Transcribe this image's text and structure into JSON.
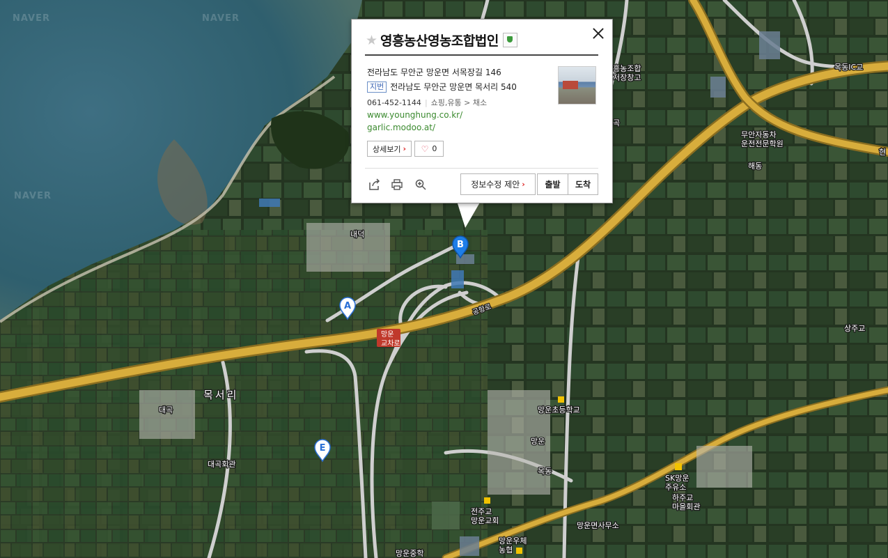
{
  "watermark": "NAVER",
  "place": {
    "name": "영흥농산영농조합법인",
    "road_address": "전라남도 무안군 망운면 서목장길 146",
    "jibun_tag": "지번",
    "jibun_address": "전라남도 무안군 망운면 목서리 540",
    "phone": "061-452-1144",
    "category": "쇼핑,유통 > 채소",
    "urls": [
      "www.younghung.co.kr/",
      "garlic.modoo.at/"
    ],
    "detail_label": "상세보기",
    "like_count": "0",
    "suggest_label": "정보수정 제안",
    "depart_label": "출발",
    "arrive_label": "도착"
  },
  "icons": {
    "star": "star-icon",
    "close": "close-icon",
    "share": "share-icon",
    "print": "print-icon",
    "zoom": "zoom-in-icon",
    "heart": "heart-icon",
    "verified": "verified-shield-icon"
  },
  "markers": [
    {
      "letter": "A",
      "color": "#ffffff",
      "text_color": "#2a6fd6"
    },
    {
      "letter": "B",
      "color": "#1e7ee8",
      "text_color": "#ffffff"
    },
    {
      "letter": "E",
      "color": "#ffffff",
      "text_color": "#2a6fd6"
    }
  ],
  "map_labels": {
    "mokseo": "목서리",
    "naedeok": "내덕",
    "daegok": "대곡",
    "daegok_hall": "대곡회관",
    "junction": "망운\n교차로",
    "road_name": "공항로",
    "mangun_elem": "망운초등학교",
    "mangun": "망운",
    "mokdong": "목동",
    "haedong": "해동",
    "mangun_office": "망운면사무소",
    "jeonju_church": "전주교\n망운교회",
    "mangun_post": "망운우체\n농협",
    "sk_station": "SK망운\n주유소",
    "hajugyo": "하주교\n마을회관",
    "sangjugyo": "상주교",
    "mokdong_ic": "목동IC교",
    "driving_school": "무안자동차\n운전전문학원",
    "warehouse": "흥농조합\n저장창고",
    "gok": "곡",
    "mangun_bottom": "망운중학",
    "hyeon": "현"
  },
  "colors": {
    "highway": "#d8ad3c",
    "road_white": "#d9d9d9",
    "sea": "#2f5f6e"
  }
}
